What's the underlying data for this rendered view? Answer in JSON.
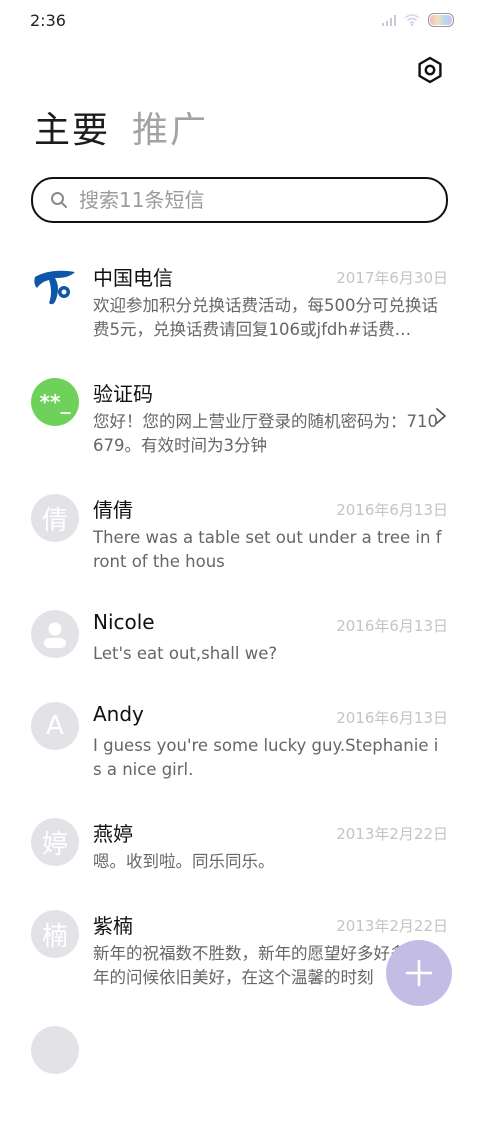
{
  "status": {
    "time": "2:36"
  },
  "tabs": [
    {
      "label": "主要",
      "active": true
    },
    {
      "label": "推广",
      "active": false
    }
  ],
  "search": {
    "placeholder": "搜索11条短信"
  },
  "conversations": [
    {
      "name": "中国电信",
      "date": "2017年6月30日",
      "preview": "欢迎参加积分兑换话费活动，每500分可兑换话费5元，兑换话费请回复106或jfdh#话费…",
      "avatar": "china-telecom-logo"
    },
    {
      "name": "验证码",
      "date": "",
      "preview": "您好！您的网上营业厅登录的随机密码为：710679。有效时间为3分钟",
      "avatar_text": "**_"
    },
    {
      "name": "倩倩",
      "date": "2016年6月13日",
      "preview": "There was a table set out under a tree in front of the hous",
      "avatar_text": "倩"
    },
    {
      "name": "Nicole",
      "date": "2016年6月13日",
      "preview": "Let's eat out,shall we?",
      "avatar": "person-icon"
    },
    {
      "name": "Andy",
      "date": "2016年6月13日",
      "preview": "I guess you're some lucky guy.Stephanie is a nice girl.",
      "avatar_text": "A"
    },
    {
      "name": "燕婷",
      "date": "2013年2月22日",
      "preview": "嗯。收到啦。同乐同乐。",
      "avatar_text": "婷"
    },
    {
      "name": "紫楠",
      "date": "2013年2月22日",
      "preview": "新年的祝福数不胜数，新年的愿望好多好多，新年的问候依旧美好，在这个温馨的时刻",
      "avatar_text": "楠"
    }
  ],
  "colors": {
    "accent_fab": "#c3bde6",
    "verify_avatar": "#6ed25a",
    "telecom_blue": "#0e56a8"
  }
}
